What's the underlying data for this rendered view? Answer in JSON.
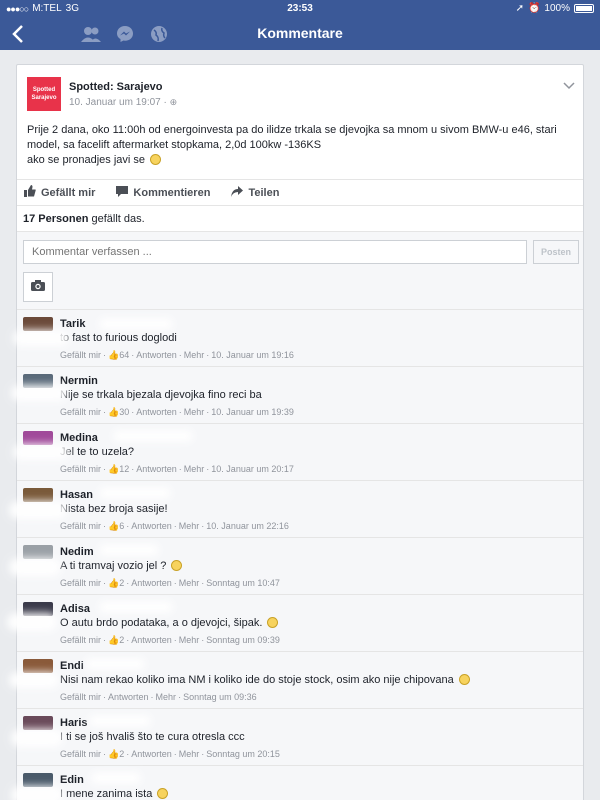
{
  "status_bar": {
    "carrier": "M:TEL",
    "network": "3G",
    "time": "23:53",
    "battery": "100%"
  },
  "nav": {
    "title": "Kommentare",
    "icons": [
      "back-chevron-icon",
      "friends-icon",
      "messenger-icon",
      "globe-icon"
    ]
  },
  "post": {
    "page_name": "Spotted: Sarajevo",
    "avatar_text_1": "Spotted",
    "avatar_text_2": "Sarajevo",
    "date": "10. Januar um 19:07 · ",
    "text_line_1": "Prije 2 dana, oko 11:00h od energoinvesta pa do ilidze trkala se djevojka sa mnom u sivom BMW-u e46, stari",
    "text_line_2": "model, sa facelift aftermarket stopkama, 2,0d 100kw -136KS",
    "text_line_3": "ako se pronadjes javi se "
  },
  "actions": {
    "like": "Gefällt mir",
    "comment": "Kommentieren",
    "share": "Teilen"
  },
  "likes": {
    "count_label": "17 Personen",
    "suffix": " gefällt das."
  },
  "composer": {
    "placeholder": "Kommentar verfassen ...",
    "post_button": "Posten"
  },
  "meta_labels": {
    "like": "Gefällt mir",
    "reply": "Antworten",
    "more": "Mehr"
  },
  "comments": [
    {
      "name": "Tarik",
      "text": "to fast to furious doglodi",
      "likes": "64",
      "time": "10. Januar um 19:16",
      "avatar_color": "#6b4a3a"
    },
    {
      "name": "Nermin",
      "text": "Nije se trkala bjezala djevojka fino reci ba",
      "likes": "30",
      "time": "10. Januar um 19:39",
      "avatar_color": "#5a6a7a"
    },
    {
      "name": "Medina",
      "text": "Jel te to uzela?",
      "likes": "12",
      "time": "10. Januar um 20:17",
      "avatar_color": "#a04a9a"
    },
    {
      "name": "Hasan",
      "text": "Nista bez broja sasije!",
      "likes": "6",
      "time": "10. Januar um 22:16",
      "avatar_color": "#7a5a3a"
    },
    {
      "name": "Nedim",
      "text": "A ti tramvaj vozio jel ? ",
      "likes": "2",
      "time": "Sonntag um 10:47",
      "avatar_color": "#9aa0a6"
    },
    {
      "name": "Adisa",
      "text": "O autu brdo podataka, a o djevojci, šipak. ",
      "likes": "2",
      "time": "Sonntag um 09:39",
      "avatar_color": "#3a3a4a"
    },
    {
      "name": "Endi",
      "text": "Nisi nam rekao koliko ima NM i koliko ide do stoje stock, osim ako nije chipovana ",
      "likes": "2",
      "time": "Sonntag um 09:36",
      "avatar_color": "#8a5a3a"
    },
    {
      "name": "Haris",
      "text": "I ti se još hvališ što te cura otresla  ccc",
      "likes": "2",
      "time": "Sonntag um 20:15",
      "avatar_color": "#6a4a5a"
    },
    {
      "name": "Edin",
      "text": "I mene zanima ista ",
      "likes": "",
      "time": "",
      "avatar_color": "#4a5a6a"
    }
  ]
}
